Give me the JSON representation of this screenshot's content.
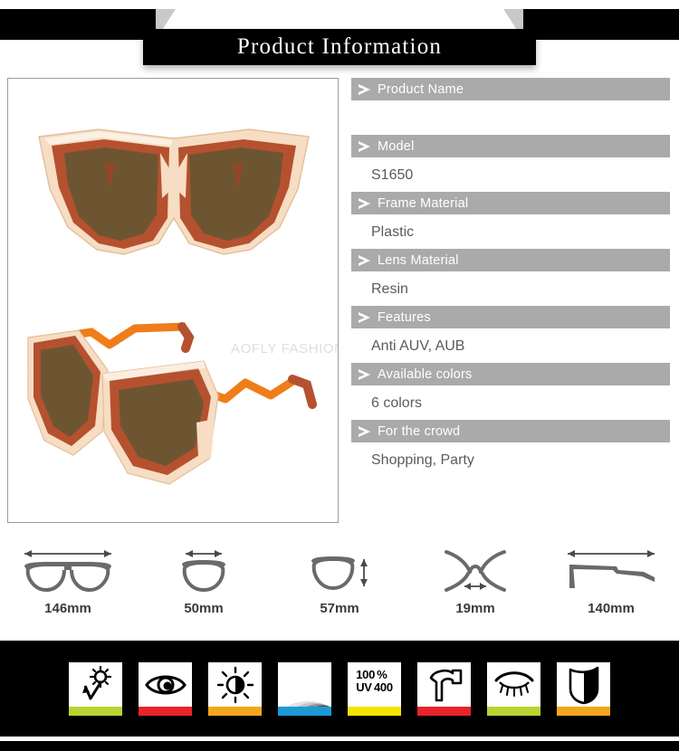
{
  "header": {
    "title": "Product Information"
  },
  "gallery": {
    "watermark": "AOFLY FASHION",
    "front_view_name": "sunglasses-front-view",
    "angle_view_name": "sunglasses-angled-view"
  },
  "specs": [
    {
      "label": "Product Name",
      "value": "",
      "faded": true
    },
    {
      "label": "Model",
      "value": "S1650",
      "faded": false
    },
    {
      "label": "Frame Material",
      "value": "Plastic",
      "faded": false
    },
    {
      "label": "Lens Material",
      "value": "Resin",
      "faded": false
    },
    {
      "label": "Features",
      "value": "Anti AUV, AUB",
      "faded": false
    },
    {
      "label": "Available colors",
      "value": "6 colors",
      "faded": false
    },
    {
      "label": "For the crowd",
      "value": "Shopping, Party",
      "faded": false
    }
  ],
  "measurements": [
    {
      "icon": "frame-total-width-icon",
      "label": "146mm"
    },
    {
      "icon": "lens-width-icon",
      "label": "50mm"
    },
    {
      "icon": "lens-height-icon",
      "label": "57mm"
    },
    {
      "icon": "bridge-width-icon",
      "label": "19mm"
    },
    {
      "icon": "temple-length-icon",
      "label": "140mm"
    }
  ],
  "features": [
    {
      "icon": "sun-protection-icon",
      "color": "#b7d433",
      "text": ""
    },
    {
      "icon": "clear-vision-eye-icon",
      "color": "#e8232a",
      "text": ""
    },
    {
      "icon": "anti-glare-sun-icon",
      "color": "#f5a71b",
      "text": ""
    },
    {
      "icon": "radiation-waves-icon",
      "color": "#1b9ad6",
      "text": ""
    },
    {
      "icon": "uv400-badge-icon",
      "color": "#f5e400",
      "text": "100 %\nUV 400"
    },
    {
      "icon": "impact-resistance-hammer-icon",
      "color": "#e8232a",
      "text": ""
    },
    {
      "icon": "eye-comfort-icon",
      "color": "#b7d433",
      "text": ""
    },
    {
      "icon": "shield-protection-icon",
      "color": "#f5a71b",
      "text": ""
    }
  ],
  "colors": {
    "ribbon": "#000000",
    "spec_header_bg": "#aaaaaa",
    "spec_value_text": "#5b5b5b",
    "frame_rust": "#b5512f",
    "frame_peach": "#f3d5b8",
    "lens_brown": "#6e5532",
    "temple_orange": "#ef7d1a"
  }
}
